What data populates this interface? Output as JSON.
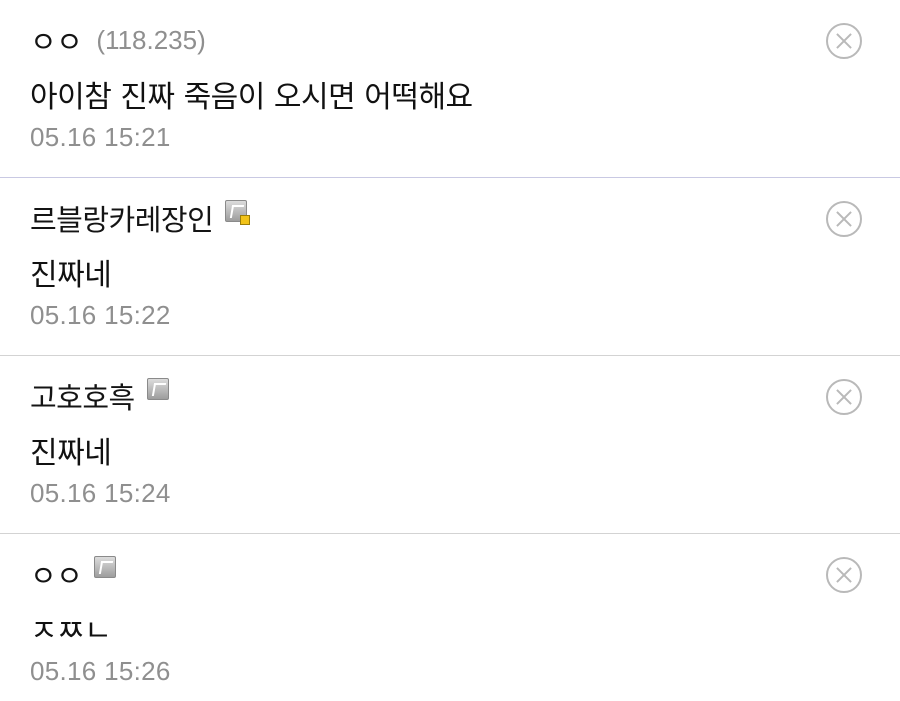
{
  "comments": [
    {
      "author": "ㅇㅇ",
      "ip": "(118.235)",
      "content": "아이참 진짜 죽음이 오시면 어떡해요",
      "timestamp": "05.16 15:21",
      "member_icon": "none"
    },
    {
      "author": "르블랑카레장인",
      "content": "진짜네",
      "timestamp": "05.16 15:22",
      "member_icon": "fixed-nick-manager-icon"
    },
    {
      "author": "고호호흑",
      "content": "진짜네",
      "timestamp": "05.16 15:24",
      "member_icon": "fixed-nick-icon"
    },
    {
      "author": "ㅇㅇ",
      "content": "ㅈㅉㄴ",
      "timestamp": "05.16 15:26",
      "member_icon": "fixed-nick-icon"
    }
  ],
  "icons": {
    "delete": "close-circle-icon"
  },
  "colors": {
    "text": "#111111",
    "meta": "#8f8f8f",
    "divider": "#d3d3d3",
    "divider_first": "#c9c9e3",
    "manager_badge": "#f2c318"
  }
}
